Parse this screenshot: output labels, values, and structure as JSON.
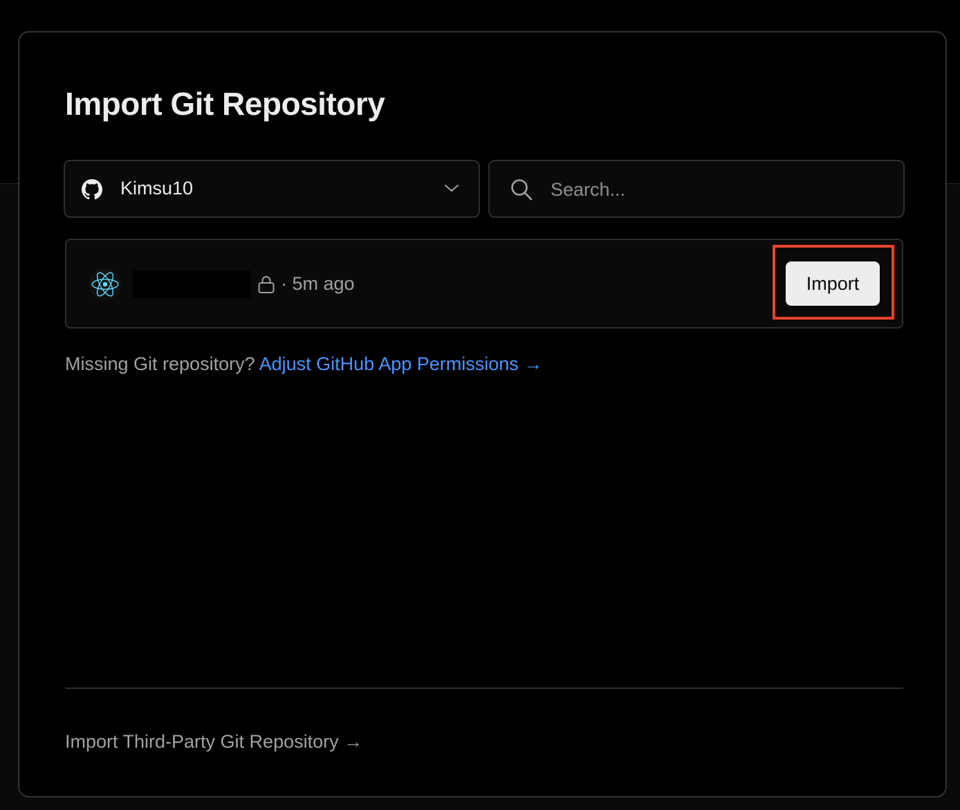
{
  "dialog": {
    "title": "Import Git Repository"
  },
  "account_selector": {
    "selected": "Kimsu10",
    "icon": "github-icon",
    "dropdown_icon": "chevron-down-icon"
  },
  "search": {
    "placeholder": "Search...",
    "value": "",
    "icon": "search-icon"
  },
  "repositories": [
    {
      "framework_icon": "react-icon",
      "name_redacted": true,
      "visibility_icon": "lock-icon",
      "updated": "· 5m ago",
      "action_label": "Import"
    }
  ],
  "missing_repo": {
    "text": "Missing Git repository?",
    "link": "Adjust GitHub App Permissions →"
  },
  "third_party_link": "Import Third-Party Git Repository →",
  "colors": {
    "background": "#000000",
    "link": "#4d94ff",
    "highlight_box": "#e5452d",
    "button_bg": "#ededed"
  }
}
